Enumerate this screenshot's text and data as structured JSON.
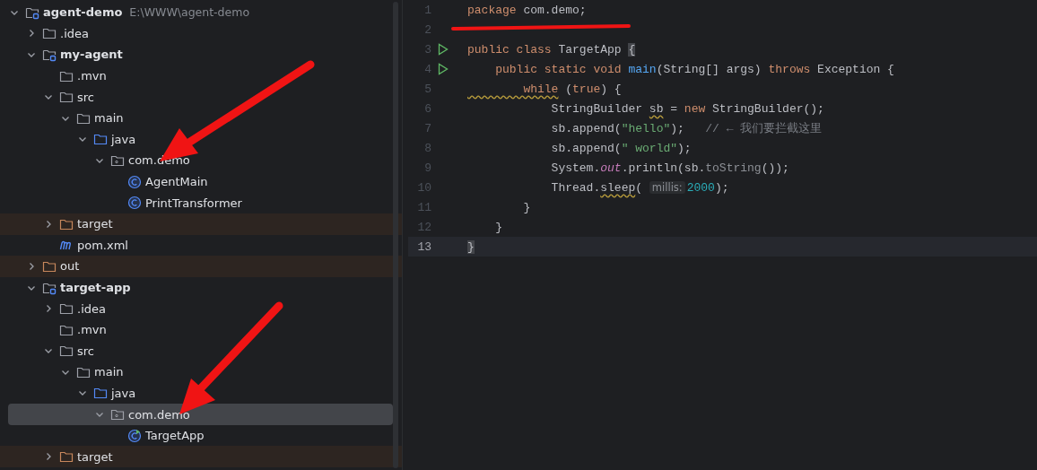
{
  "project_tree": [
    {
      "label": "agent-demo",
      "path": "E:\\WWW\\agent-demo",
      "kind": "module",
      "expanded": true,
      "selected": false,
      "children": [
        {
          "label": ".idea",
          "kind": "folder",
          "expanded": false,
          "selected": false
        },
        {
          "label": "my-agent",
          "kind": "module",
          "expanded": true,
          "selected": false,
          "children": [
            {
              "label": ".mvn",
              "kind": "folder",
              "selected": false
            },
            {
              "label": "src",
              "kind": "folder",
              "expanded": true,
              "selected": false,
              "children": [
                {
                  "label": "main",
                  "kind": "folder",
                  "expanded": true,
                  "selected": false,
                  "children": [
                    {
                      "label": "java",
                      "kind": "source-folder",
                      "expanded": true,
                      "selected": false,
                      "children": [
                        {
                          "label": "com.demo",
                          "kind": "package",
                          "expanded": true,
                          "selected": false,
                          "children": [
                            {
                              "label": "AgentMain",
                              "kind": "class",
                              "selected": false
                            },
                            {
                              "label": "PrintTransformer",
                              "kind": "class",
                              "selected": false
                            }
                          ]
                        }
                      ]
                    }
                  ]
                }
              ]
            },
            {
              "label": "target",
              "kind": "excluded-folder",
              "expanded": false,
              "selected": false
            },
            {
              "label": "pom.xml",
              "kind": "maven-file",
              "selected": false
            }
          ]
        },
        {
          "label": "out",
          "kind": "excluded-folder",
          "expanded": false,
          "selected": false
        },
        {
          "label": "target-app",
          "kind": "module",
          "expanded": true,
          "selected": false,
          "children": [
            {
              "label": ".idea",
              "kind": "folder",
              "expanded": false,
              "selected": false
            },
            {
              "label": ".mvn",
              "kind": "folder",
              "selected": false
            },
            {
              "label": "src",
              "kind": "folder",
              "expanded": true,
              "selected": false,
              "children": [
                {
                  "label": "main",
                  "kind": "folder",
                  "expanded": true,
                  "selected": false,
                  "children": [
                    {
                      "label": "java",
                      "kind": "source-folder",
                      "expanded": true,
                      "selected": false,
                      "children": [
                        {
                          "label": "com.demo",
                          "kind": "package",
                          "expanded": true,
                          "selected": true,
                          "children": [
                            {
                              "label": "TargetApp",
                              "kind": "main-class",
                              "selected": false
                            }
                          ]
                        }
                      ]
                    }
                  ]
                }
              ]
            },
            {
              "label": "target",
              "kind": "excluded-folder",
              "expanded": false,
              "selected": false
            }
          ]
        }
      ]
    }
  ],
  "editor": {
    "lines": [
      {
        "number": "1",
        "run": false,
        "current": false,
        "tokens": [
          {
            "kind": "keyword",
            "text": "package"
          },
          {
            "kind": "plain",
            "text": " com.demo;"
          }
        ]
      },
      {
        "number": "2",
        "run": false,
        "current": false
      },
      {
        "number": "3",
        "run": true,
        "current": false,
        "tokens": [
          {
            "kind": "keyword",
            "text": "public class"
          },
          {
            "kind": "plain",
            "text": " TargetApp "
          },
          {
            "kind": "plain",
            "text": "{",
            "matched": true
          }
        ]
      },
      {
        "number": "4",
        "run": true,
        "current": false,
        "tokens": [
          {
            "kind": "keyword",
            "text": "    public static void "
          },
          {
            "kind": "declaration",
            "text": "main"
          },
          {
            "kind": "plain",
            "text": "(String[] args) "
          },
          {
            "kind": "keyword",
            "text": "throws"
          },
          {
            "kind": "plain",
            "text": " Exception {"
          }
        ]
      },
      {
        "number": "5",
        "run": false,
        "current": false,
        "tokens": [
          {
            "kind": "keyword",
            "text": "        while",
            "warning": true
          },
          {
            "kind": "plain",
            "text": " ("
          },
          {
            "kind": "keyword",
            "text": "true"
          },
          {
            "kind": "plain",
            "text": ") {"
          }
        ]
      },
      {
        "number": "6",
        "run": false,
        "current": false,
        "tokens": [
          {
            "kind": "plain",
            "text": "            StringBuilder "
          },
          {
            "kind": "plain",
            "text": "sb",
            "warning": true
          },
          {
            "kind": "plain",
            "text": " = "
          },
          {
            "kind": "keyword",
            "text": "new"
          },
          {
            "kind": "plain",
            "text": " StringBuilder();"
          }
        ]
      },
      {
        "number": "7",
        "run": false,
        "current": false,
        "tokens": [
          {
            "kind": "plain",
            "text": "            sb.append("
          },
          {
            "kind": "string",
            "text": "\"hello\""
          },
          {
            "kind": "plain",
            "text": ");   "
          },
          {
            "kind": "comment",
            "text": "// ← 我们要拦截这里"
          }
        ]
      },
      {
        "number": "8",
        "run": false,
        "current": false,
        "tokens": [
          {
            "kind": "plain",
            "text": "            sb.append("
          },
          {
            "kind": "string",
            "text": "\" world\""
          },
          {
            "kind": "plain",
            "text": ");"
          }
        ]
      },
      {
        "number": "9",
        "run": false,
        "current": false,
        "tokens": [
          {
            "kind": "plain",
            "text": "            System."
          },
          {
            "kind": "static-field",
            "text": "out"
          },
          {
            "kind": "plain",
            "text": ".println(sb."
          },
          {
            "kind": "redundant",
            "text": "toString"
          },
          {
            "kind": "plain",
            "text": "());"
          }
        ]
      },
      {
        "number": "10",
        "run": false,
        "current": false,
        "tokens": [
          {
            "kind": "plain",
            "text": "            Thread."
          },
          {
            "kind": "plain",
            "text": "sleep",
            "warning": true
          },
          {
            "kind": "plain",
            "text": "( "
          },
          {
            "kind": "hint",
            "text": "millis:"
          },
          {
            "kind": "number",
            "text": "2000"
          },
          {
            "kind": "plain",
            "text": ");"
          }
        ]
      },
      {
        "number": "11",
        "run": false,
        "current": false,
        "tokens": [
          {
            "kind": "plain",
            "text": "        }"
          }
        ]
      },
      {
        "number": "12",
        "run": false,
        "current": false,
        "tokens": [
          {
            "kind": "plain",
            "text": "    }"
          }
        ]
      },
      {
        "number": "13",
        "run": false,
        "current": true,
        "tokens": [
          {
            "kind": "plain",
            "text": "}",
            "matched": true
          }
        ]
      }
    ]
  }
}
